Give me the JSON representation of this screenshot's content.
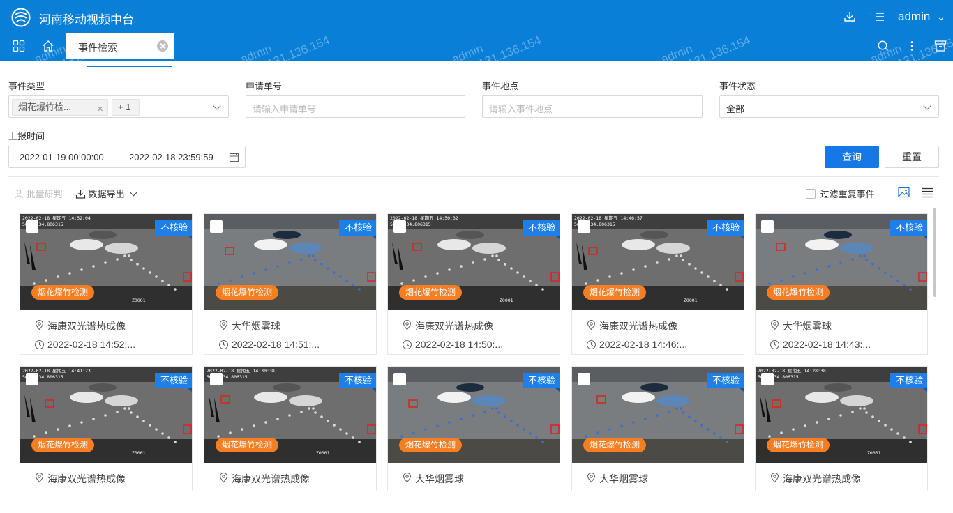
{
  "header": {
    "app_title": "河南移动视频中台",
    "user": "admin",
    "tabs": [
      {
        "label": "事件检索"
      }
    ]
  },
  "filters": {
    "event_type": {
      "label": "事件类型",
      "chip": "烟花爆竹检...",
      "more": "+ 1"
    },
    "apply_no": {
      "label": "申请单号",
      "placeholder": "请输入申请单号"
    },
    "location": {
      "label": "事件地点",
      "placeholder": "请输入事件地点"
    },
    "status": {
      "label": "事件状态",
      "value": "全部"
    },
    "report_time": {
      "label": "上报时间",
      "start": "2022-01-19 00:00:00",
      "separator": "-",
      "end": "2022-02-18 23:59:59"
    },
    "query_label": "查询",
    "reset_label": "重置"
  },
  "toolbar": {
    "batch_label": "批量研判",
    "export_label": "数据导出",
    "filter_dup_label": "过滤重复事件"
  },
  "cards": [
    {
      "badge": "不核验",
      "tag": "烟花爆竹检测",
      "location": "海康双光谱热成像",
      "time": "2022-02-18 14:52:...",
      "scene": "thermal",
      "overlay": "2022-02-18 星期五 14:52:04"
    },
    {
      "badge": "不核验",
      "tag": "烟花爆竹检测",
      "location": "大华烟雾球",
      "time": "2022-02-18 14:51:...",
      "scene": "color",
      "overlay": ""
    },
    {
      "badge": "不核验",
      "tag": "烟花爆竹检测",
      "location": "海康双光谱热成像",
      "time": "2022-02-18 14:50:...",
      "scene": "thermal",
      "overlay": "2022-02-18 星期五 14:50:32"
    },
    {
      "badge": "不核验",
      "tag": "烟花爆竹检测",
      "location": "海康双光谱热成像",
      "time": "2022-02-18 14:46:...",
      "scene": "thermal",
      "overlay": "2022-02-18 星期五 14:46:57"
    },
    {
      "badge": "不核验",
      "tag": "烟花爆竹检测",
      "location": "大华烟雾球",
      "time": "2022-02-18 14:43:...",
      "scene": "color",
      "overlay": ""
    },
    {
      "badge": "不核验",
      "tag": "烟花爆竹检测",
      "location": "海康双光谱热成像",
      "time": "",
      "scene": "thermal",
      "overlay": "2022-02-18 星期五 14:41:23"
    },
    {
      "badge": "不核验",
      "tag": "烟花爆竹检测",
      "location": "海康双光谱热成像",
      "time": "",
      "scene": "thermal",
      "overlay": "2022-02-18 星期五 14:30:38"
    },
    {
      "badge": "不核验",
      "tag": "烟花爆竹检测",
      "location": "大华烟雾球",
      "time": "",
      "scene": "color",
      "overlay": ""
    },
    {
      "badge": "不核验",
      "tag": "烟花爆竹检测",
      "location": "大华烟雾球",
      "time": "",
      "scene": "color",
      "overlay": ""
    },
    {
      "badge": "不核验",
      "tag": "烟花爆竹检测",
      "location": "海康双光谱热成像",
      "time": "",
      "scene": "thermal",
      "overlay": "2022-02-18 星期五 14:28:38"
    }
  ],
  "overlay_coords": "56061,34.806315",
  "overlay_camera_label": "Z0001",
  "watermark": {
    "user": "admin",
    "ip": "221.131.136.154"
  },
  "colors": {
    "brand": "#0a7fd8",
    "primary_button": "#1677e6",
    "badge": "#1e7fe9",
    "tag": "#f57d22"
  }
}
